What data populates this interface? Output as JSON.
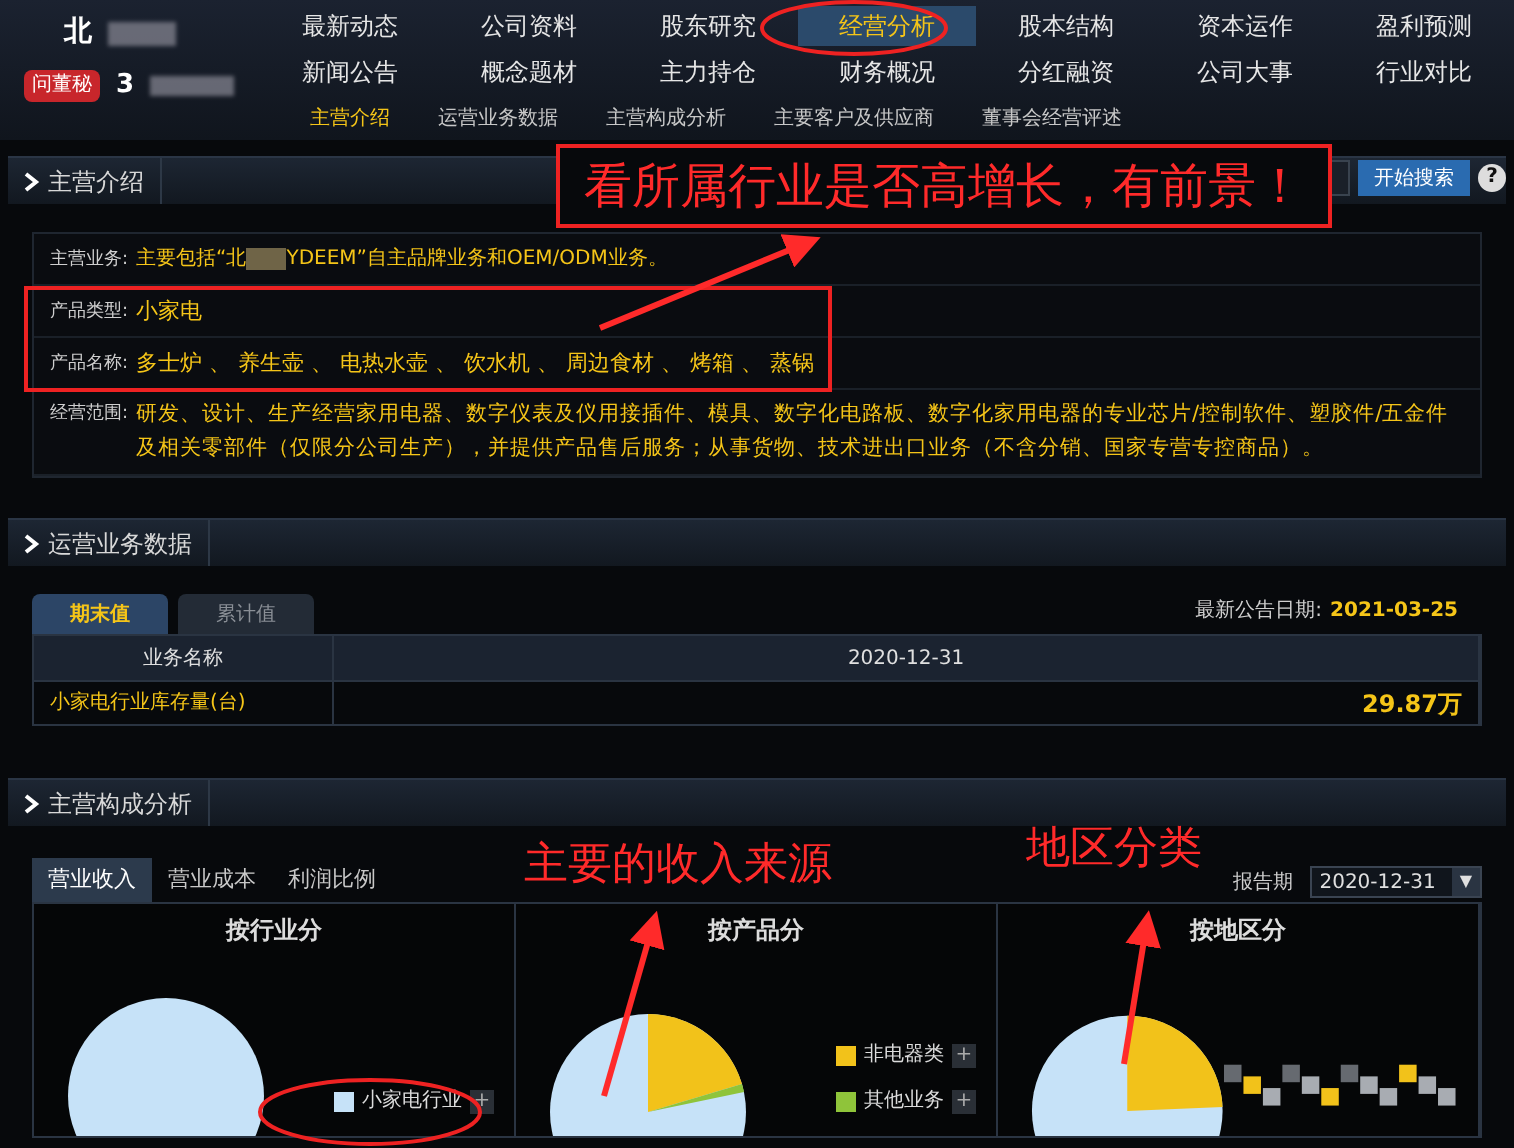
{
  "stock": {
    "badge": "问董秘",
    "name": "北",
    "code": "3"
  },
  "nav": [
    [
      {
        "label": "最新动态",
        "selected": false
      },
      {
        "label": "公司资料",
        "selected": false
      },
      {
        "label": "股东研究",
        "selected": false
      },
      {
        "label": "经营分析",
        "selected": true
      },
      {
        "label": "股本结构",
        "selected": false
      },
      {
        "label": "资本运作",
        "selected": false
      },
      {
        "label": "盈利预测",
        "selected": false
      }
    ],
    [
      {
        "label": "新闻公告",
        "selected": false
      },
      {
        "label": "概念题材",
        "selected": false
      },
      {
        "label": "主力持仓",
        "selected": false
      },
      {
        "label": "财务概况",
        "selected": false
      },
      {
        "label": "分红融资",
        "selected": false
      },
      {
        "label": "公司大事",
        "selected": false
      },
      {
        "label": "行业对比",
        "selected": false
      }
    ]
  ],
  "subnav": [
    {
      "label": "主营介绍",
      "selected": true
    },
    {
      "label": "运营业务数据",
      "selected": false
    },
    {
      "label": "主营构成分析",
      "selected": false
    },
    {
      "label": "主要客户及供应商",
      "selected": false
    },
    {
      "label": "董事会经营评述",
      "selected": false
    }
  ],
  "search": {
    "button": "开始搜索",
    "help": "?"
  },
  "intro": {
    "title": "主营介绍",
    "rows": [
      {
        "kind": "redacted",
        "label": "主营业务:",
        "before": "主要包括“北",
        "after": "YDEEM”自主品牌业务和OEM/ODM业务。"
      },
      {
        "kind": "text",
        "label": "产品类型:",
        "value": "小家电"
      },
      {
        "kind": "text",
        "label": "产品名称:",
        "value": "多士炉 、 养生壶 、 电热水壶 、 饮水机 、 周边食材 、 烤箱 、 蒸锅"
      },
      {
        "kind": "text",
        "label": "经营范围:",
        "value": "研发、设计、生产经营家用电器、数字仪表及仪用接插件、模具、数字化电路板、数字化家用电器的专业芯片/控制软件、塑胶件/五金件及相关零部件（仅限分公司生产），并提供产品售后服务；从事货物、技术进出口业务（不含分销、国家专营专控商品）。"
      }
    ]
  },
  "operations": {
    "title": "运营业务数据",
    "tabs": [
      {
        "label": "期末值",
        "selected": true
      },
      {
        "label": "累计值",
        "selected": false
      }
    ],
    "date_label": "最新公告日期:",
    "date": "2021-03-25",
    "columns": [
      "业务名称",
      "2020-12-31"
    ],
    "rows": [
      [
        "小家电行业库存量(台)",
        "29.87万"
      ]
    ]
  },
  "composition": {
    "title": "主营构成分析",
    "tabs": [
      {
        "label": "营业收入",
        "selected": true
      },
      {
        "label": "营业成本",
        "selected": false
      },
      {
        "label": "利润比例",
        "selected": false
      }
    ],
    "period_label": "报告期",
    "period": "2020-12-31",
    "period_caret": "▼",
    "panels": [
      {
        "title": "按行业分",
        "kind": "single",
        "legend": [
          {
            "label": "小家电行业",
            "color": "#c6e2f8",
            "expand": "+"
          }
        ]
      },
      {
        "title": "按产品分",
        "kind": "wedge",
        "legend": [
          {
            "label": "非电器类",
            "color": "#f2c21a",
            "expand": "+"
          },
          {
            "label": "其他业务",
            "color": "#8fc43a",
            "expand": "+"
          }
        ]
      },
      {
        "title": "按地区分",
        "kind": "redacted"
      }
    ]
  },
  "annotations": [
    {
      "text": "看所属行业是否高增长，有前景！"
    },
    {
      "text": "主要的收入来源"
    },
    {
      "text": "地区分类"
    }
  ]
}
